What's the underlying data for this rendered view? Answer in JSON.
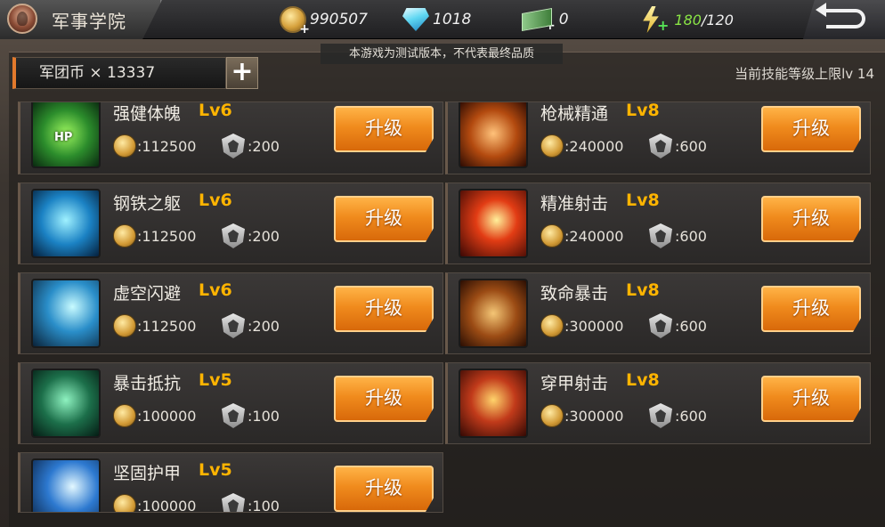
{
  "header": {
    "title": "军事学院",
    "gold": "990507",
    "diamonds": "1018",
    "cash": "0",
    "energy_current": "180",
    "energy_max": "/120"
  },
  "notice": "本游戏为测试版本，不代表最终品质",
  "legion": {
    "label": "军团币 × 13337",
    "add_label": "+"
  },
  "skill_limit": "当前技能等级上限lv 14",
  "upgrade_label": "升级",
  "skills": [
    {
      "name": "强健体魄",
      "level": "Lv6",
      "coin": ":112500",
      "medal": ":200",
      "icon": "hp-icon",
      "icon_text": "HP"
    },
    {
      "name": "枪械精通",
      "level": "Lv8",
      "coin": ":240000",
      "medal": ":600",
      "icon": "rifle-icon",
      "icon_text": ""
    },
    {
      "name": "钢铁之躯",
      "level": "Lv6",
      "coin": ":112500",
      "medal": ":200",
      "icon": "steel-body-icon",
      "icon_text": ""
    },
    {
      "name": "精准射击",
      "level": "Lv8",
      "coin": ":240000",
      "medal": ":600",
      "icon": "target-icon",
      "icon_text": ""
    },
    {
      "name": "虚空闪避",
      "level": "Lv6",
      "coin": ":112500",
      "medal": ":200",
      "icon": "dodge-icon",
      "icon_text": ""
    },
    {
      "name": "致命暴击",
      "level": "Lv8",
      "coin": ":300000",
      "medal": ":600",
      "icon": "skull-icon",
      "icon_text": ""
    },
    {
      "name": "暴击抵抗",
      "level": "Lv5",
      "coin": ":100000",
      "medal": ":100",
      "icon": "helmet-icon",
      "icon_text": ""
    },
    {
      "name": "穿甲射击",
      "level": "Lv8",
      "coin": ":300000",
      "medal": ":600",
      "icon": "armor-pierce-icon",
      "icon_text": ""
    },
    {
      "name": "坚固护甲",
      "level": "Lv5",
      "coin": ":100000",
      "medal": ":100",
      "icon": "armor-icon",
      "icon_text": ""
    }
  ]
}
